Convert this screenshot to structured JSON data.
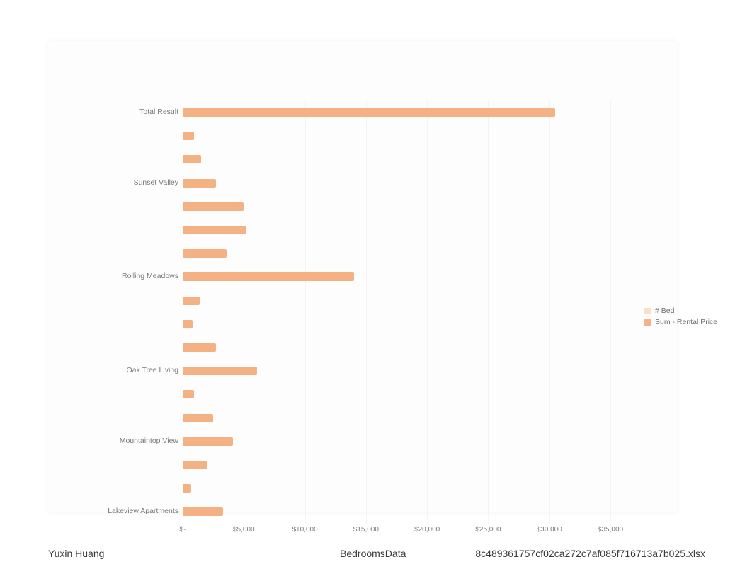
{
  "chart_data": {
    "type": "bar",
    "orientation": "horizontal",
    "series_label": "Sum - Rental Price",
    "secondary_label": "# Bed",
    "xlabel": "",
    "ylabel": "",
    "xlim": [
      0,
      35000
    ],
    "x_ticks": [
      "$-",
      "$5,000",
      "$10,000",
      "$15,000",
      "$20,000",
      "$25,000",
      "$30,000",
      "$35,000"
    ],
    "x_tick_values": [
      0,
      5000,
      10000,
      15000,
      20000,
      25000,
      30000,
      35000
    ],
    "visible_y_labels": [
      "Total Result",
      "Sunset Valley",
      "Rolling Meadows",
      "Oak Tree Living",
      "Mountaintop View",
      "Lakeview Apartments"
    ],
    "bars_top_to_bottom": [
      {
        "slot": 0,
        "label_visible": "Total Result",
        "value": 30500
      },
      {
        "slot": 1,
        "label_visible": "",
        "value": 900
      },
      {
        "slot": 2,
        "label_visible": "",
        "value": 1500
      },
      {
        "slot": 3,
        "label_visible": "Sunset Valley",
        "value": 2700
      },
      {
        "slot": 4,
        "label_visible": "",
        "value": 5000
      },
      {
        "slot": 5,
        "label_visible": "",
        "value": 5200
      },
      {
        "slot": 6,
        "label_visible": "",
        "value": 3600
      },
      {
        "slot": 7,
        "label_visible": "Rolling Meadows",
        "value": 14000
      },
      {
        "slot": 8,
        "label_visible": "",
        "value": 1400
      },
      {
        "slot": 9,
        "label_visible": "",
        "value": 800
      },
      {
        "slot": 10,
        "label_visible": "",
        "value": 2700
      },
      {
        "slot": 11,
        "label_visible": "Oak Tree Living",
        "value": 6100
      },
      {
        "slot": 12,
        "label_visible": "",
        "value": 900
      },
      {
        "slot": 13,
        "label_visible": "",
        "value": 2500
      },
      {
        "slot": 14,
        "label_visible": "Mountaintop View",
        "value": 4100
      },
      {
        "slot": 15,
        "label_visible": "",
        "value": 2000
      },
      {
        "slot": 16,
        "label_visible": "",
        "value": 700
      },
      {
        "slot": 17,
        "label_visible": "Lakeview Apartments",
        "value": 3300
      }
    ],
    "bar_color": "#f4b183"
  },
  "legend": {
    "items": [
      "# Bed",
      "Sum - Rental Price"
    ]
  },
  "footer": {
    "author": "Yuxin Huang",
    "sheet": "BedroomsData",
    "filename": "8c489361757cf02ca272c7af085f716713a7b025.xlsx"
  }
}
